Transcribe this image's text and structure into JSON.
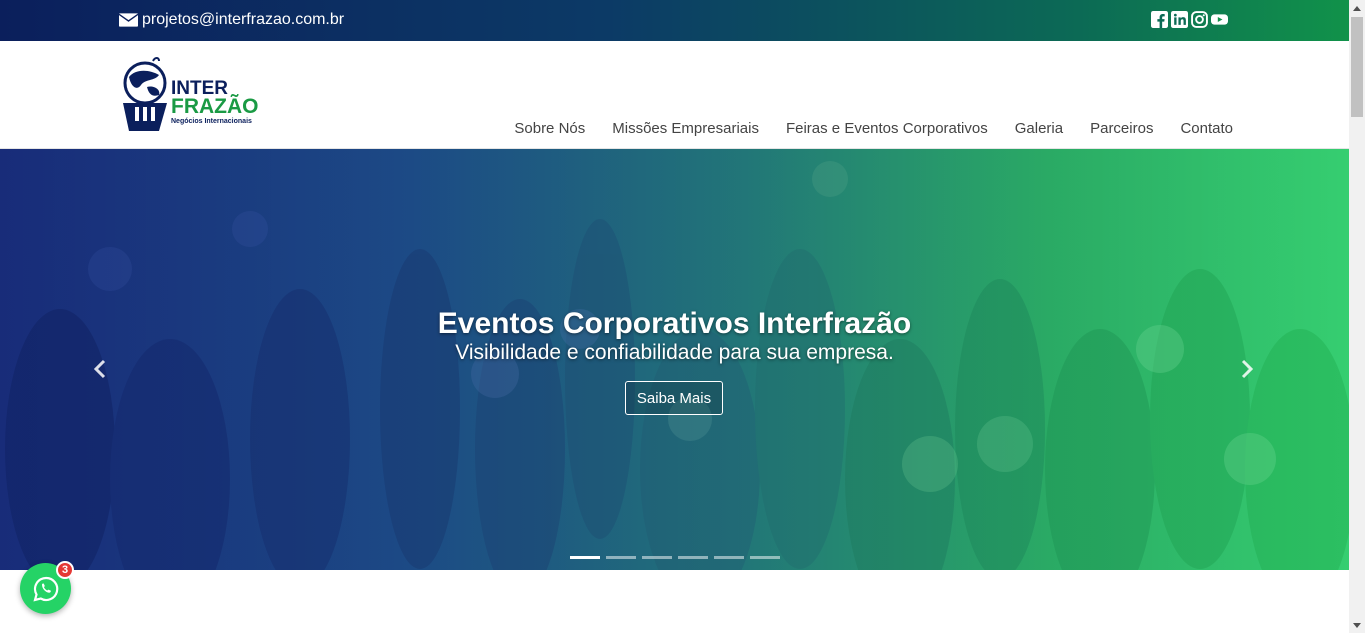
{
  "topbar": {
    "email": "projetos@interfrazao.com.br",
    "socials": [
      "facebook-icon",
      "linkedin-icon",
      "instagram-icon",
      "youtube-icon"
    ]
  },
  "logo": {
    "line1": "INTER",
    "line2": "FRAZÃO",
    "tagline": "Negócios Internacionais"
  },
  "nav": {
    "items": [
      {
        "label": "Sobre Nós"
      },
      {
        "label": "Missões Empresariais"
      },
      {
        "label": "Feiras e Eventos Corporativos"
      },
      {
        "label": "Galeria"
      },
      {
        "label": "Parceiros"
      },
      {
        "label": "Contato"
      }
    ]
  },
  "hero": {
    "title": "Eventos Corporativos Interfrazão",
    "subtitle": "Visibilidade e confiabilidade para sua empresa.",
    "button": "Saiba Mais",
    "slide_count": 6,
    "active_slide": 1
  },
  "whatsapp": {
    "badge": "3"
  },
  "colors": {
    "brand_blue": "#0b1f5c",
    "brand_green": "#1a9a44",
    "whatsapp": "#25d366"
  }
}
